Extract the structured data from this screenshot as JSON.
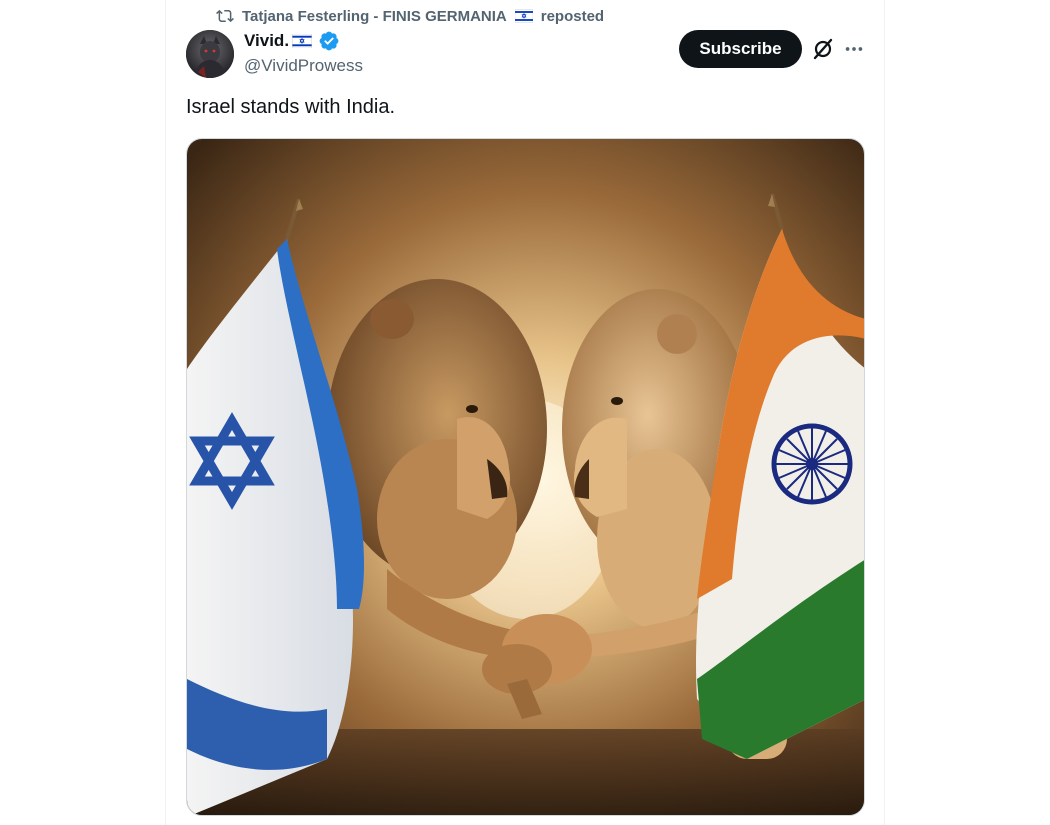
{
  "repost": {
    "reposter_name": "Tatjana Festerling - FINIS GERMANIA",
    "suffix": "reposted",
    "icon": "repost-icon"
  },
  "author": {
    "display_name": "Vivid.",
    "handle": "@VividProwess",
    "verified": true,
    "flag_icon": "israel-flag-icon"
  },
  "actions": {
    "subscribe_label": "Subscribe",
    "grok_icon": "grok-icon",
    "more_icon": "more-icon"
  },
  "tweet": {
    "text": "Israel stands with India."
  },
  "media": {
    "description_icon": "lions-handshake-image"
  },
  "colors": {
    "text_primary": "#0f1419",
    "text_secondary": "#536471",
    "verified_blue": "#1d9bf0",
    "button_dark": "#0f1419",
    "israel_blue": "#0038b8",
    "india_saffron": "#ff9933",
    "india_green": "#138808",
    "chakra_navy": "#000080"
  }
}
